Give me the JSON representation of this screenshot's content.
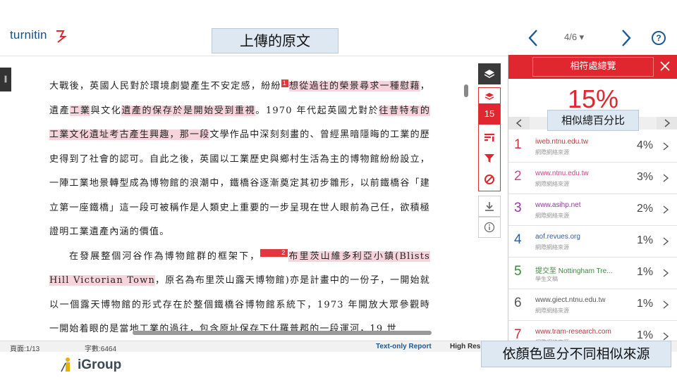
{
  "header": {
    "logo_text": "turnitin",
    "page_indicator": "4/6 ▾",
    "help": "?"
  },
  "annotations": {
    "original_text": "上傳的原文",
    "similarity_total": "相似總百分比",
    "color_sources": "依顏色區分不同相似來源"
  },
  "document": {
    "paragraphs": [
      {
        "segments": [
          {
            "text": "大戰後，英國人民對於環境劇變產生不安定感，紛紛",
            "hl": false
          },
          {
            "mark": "1"
          },
          {
            "text": "想從過往的榮景尋求一種慰藉",
            "hl": true
          },
          {
            "text": "，遺產",
            "hl": false
          },
          {
            "text": "工業",
            "hl": true
          },
          {
            "text": "與文化",
            "hl": false
          },
          {
            "text": "遺產的保存於是開始受到重視",
            "hl": true
          },
          {
            "text": "。1970 年代起英國尤對於",
            "hl": false
          },
          {
            "text": "往昔特有的工業文化遺址考古產生興趣，那一段",
            "hl": true
          },
          {
            "text": "文學作品中深刻刻畫的、曾經黑暗隱晦的工業的歷史得到了社會的認可。自此之後，英國以工業歷史與鄉村生活為主的博物館紛紛設立，一陣工業地景轉型成為博物館的浪潮中，鐵橋谷逐漸奠定其初步雛形，以前鐵橋谷「建立第一座鐵橋」這一段可被稱作是人類史上重要的一步呈現在世人眼前為己任，欲積極證明工業遺產內涵的價值。",
            "hl": false
          }
        ]
      },
      {
        "indent": true,
        "segments": [
          {
            "text": "在發展整個河谷作為博物館群的框架下，",
            "hl": false
          },
          {
            "mark": "2"
          },
          {
            "text": "布里茨山維多利亞小鎮(Blists Hill Victorian Town",
            "hl": true
          },
          {
            "text": "，原名為布里茨山露天博物館)亦是計畫中的一份子，一開始就以一個露天博物館的形式存在於整個鐵橋谷博物館系統下，1973 年開放大眾參觀時一開始着眼的是當地工業的過往，包含原址保存下什羅普郡的一段運河，19 世",
            "hl": false
          }
        ]
      }
    ]
  },
  "tools": {
    "score": "15"
  },
  "panel": {
    "title": "相符處總覽",
    "score": "15%",
    "matches": [
      {
        "num": "1",
        "source": "iweb.ntnu.edu.tw",
        "type": "網際網絡來源",
        "pct": "4%",
        "color": "#c6333b"
      },
      {
        "num": "2",
        "source": "www.ntnu.edu.tw",
        "type": "網際網絡來源",
        "pct": "3%",
        "color": "#d4408a"
      },
      {
        "num": "3",
        "source": "www.asihp.net",
        "type": "網際網絡來源",
        "pct": "2%",
        "color": "#8f3a9a"
      },
      {
        "num": "4",
        "source": "aof.revues.org",
        "type": "網際網絡來源",
        "pct": "1%",
        "color": "#2f5f9c"
      },
      {
        "num": "5",
        "source": "提交至 Nottingham Tre...",
        "type": "學生文稿",
        "pct": "1%",
        "color": "#3b8a3c"
      },
      {
        "num": "6",
        "source": "www.giect.ntnu.edu.tw",
        "type": "網際網絡來源",
        "pct": "1%",
        "color": "#555555"
      },
      {
        "num": "7",
        "source": "www.tram-research.com",
        "type": "網際網絡來源",
        "pct": "1%",
        "color": "#c6333b"
      }
    ]
  },
  "status": {
    "page": "頁面:1/13",
    "words": "字數:6464",
    "text_only": "Text-only Report",
    "high_res": "High Res"
  },
  "watermark": {
    "text": "iGroup"
  },
  "colors": {
    "brand_red": "#e0262e",
    "highlight": "#f7d4dc",
    "link_blue": "#1b5a93"
  }
}
